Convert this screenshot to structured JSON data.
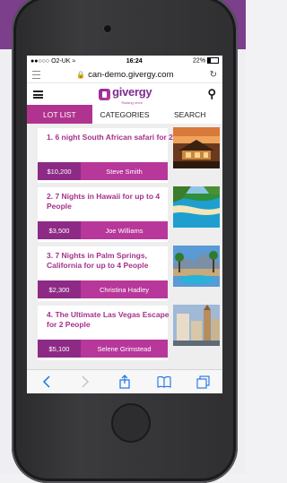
{
  "status_bar": {
    "carrier": "●●○○○ O2-UK",
    "wifi_icon": "wifi-icon",
    "time": "16:24",
    "battery": "22%"
  },
  "url_bar": {
    "url": "can-demo.givergy.com"
  },
  "app_header": {
    "logo_text": "givergy",
    "logo_tagline": "Raising more"
  },
  "tabs": [
    {
      "label": "LOT LIST",
      "active": true
    },
    {
      "label": "CATEGORIES",
      "active": false
    },
    {
      "label": "SEARCH",
      "active": false
    }
  ],
  "lots": [
    {
      "title": "1. 6 night South African safari for 2",
      "price": "$10,200",
      "seller": "Steve Smith",
      "image": "safari-lodge"
    },
    {
      "title": "2. 7 Nights in Hawaii for up to 4 People",
      "price": "$3,500",
      "seller": "Joe Williams",
      "image": "hawaii-beach"
    },
    {
      "title": "3. 7 Nights in Palm Springs, California for up to 4 People",
      "price": "$2,300",
      "seller": "Christina Hadley",
      "image": "palm-springs-pool"
    },
    {
      "title": "4. The Ultimate Las Vegas Escape for 2 People",
      "price": "$5,100",
      "seller": "Selene Grimstead",
      "image": "las-vegas-hotel"
    }
  ],
  "colors": {
    "brand_purple": "#7e2b91",
    "tab_active": "#b0348f",
    "price_bg": "#8d2a85",
    "seller_bg": "#b7379a",
    "title_color": "#a4318b"
  }
}
